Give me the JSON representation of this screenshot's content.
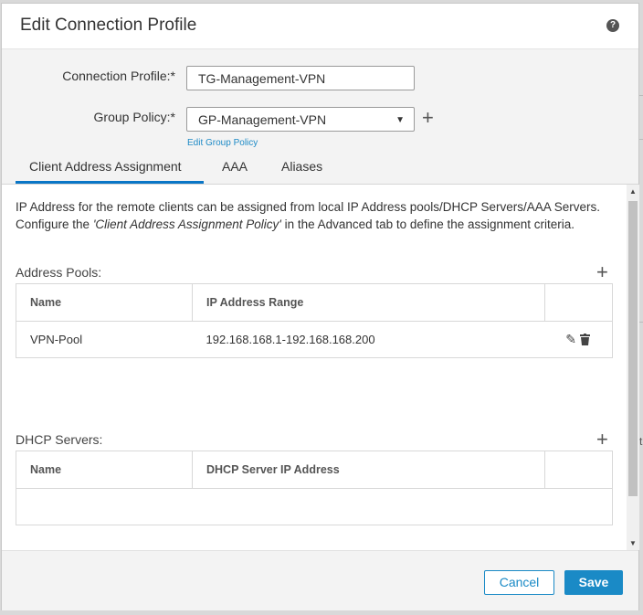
{
  "dialog": {
    "title": "Edit Connection Profile",
    "help_icon": "question-circle-icon"
  },
  "form": {
    "connection_profile_label": "Connection Profile:*",
    "connection_profile_value": "TG-Management-VPN",
    "group_policy_label": "Group Policy:*",
    "group_policy_value": "GP-Management-VPN",
    "edit_group_policy_link": "Edit Group Policy"
  },
  "tabs": [
    {
      "label": "Client Address Assignment",
      "active": true
    },
    {
      "label": "AAA",
      "active": false
    },
    {
      "label": "Aliases",
      "active": false
    }
  ],
  "content": {
    "intro_part1": "IP Address for the remote clients can be assigned from local IP Address pools/DHCP Servers/AAA Servers. Configure the ",
    "intro_policy": "'Client Address Assignment Policy'",
    "intro_part2": " in the Advanced tab to define the assignment criteria.",
    "address_pools": {
      "label": "Address Pools:",
      "columns": [
        "Name",
        "IP Address Range"
      ],
      "rows": [
        {
          "name": "VPN-Pool",
          "range": "192.168.168.1-192.168.168.200"
        }
      ]
    },
    "dhcp_servers": {
      "label": "DHCP Servers:",
      "columns": [
        "Name",
        "DHCP Server IP Address"
      ]
    }
  },
  "footer": {
    "cancel_label": "Cancel",
    "save_label": "Save"
  },
  "colors": {
    "accent": "#1a8ac6",
    "tab_underline": "#0a76c6"
  }
}
